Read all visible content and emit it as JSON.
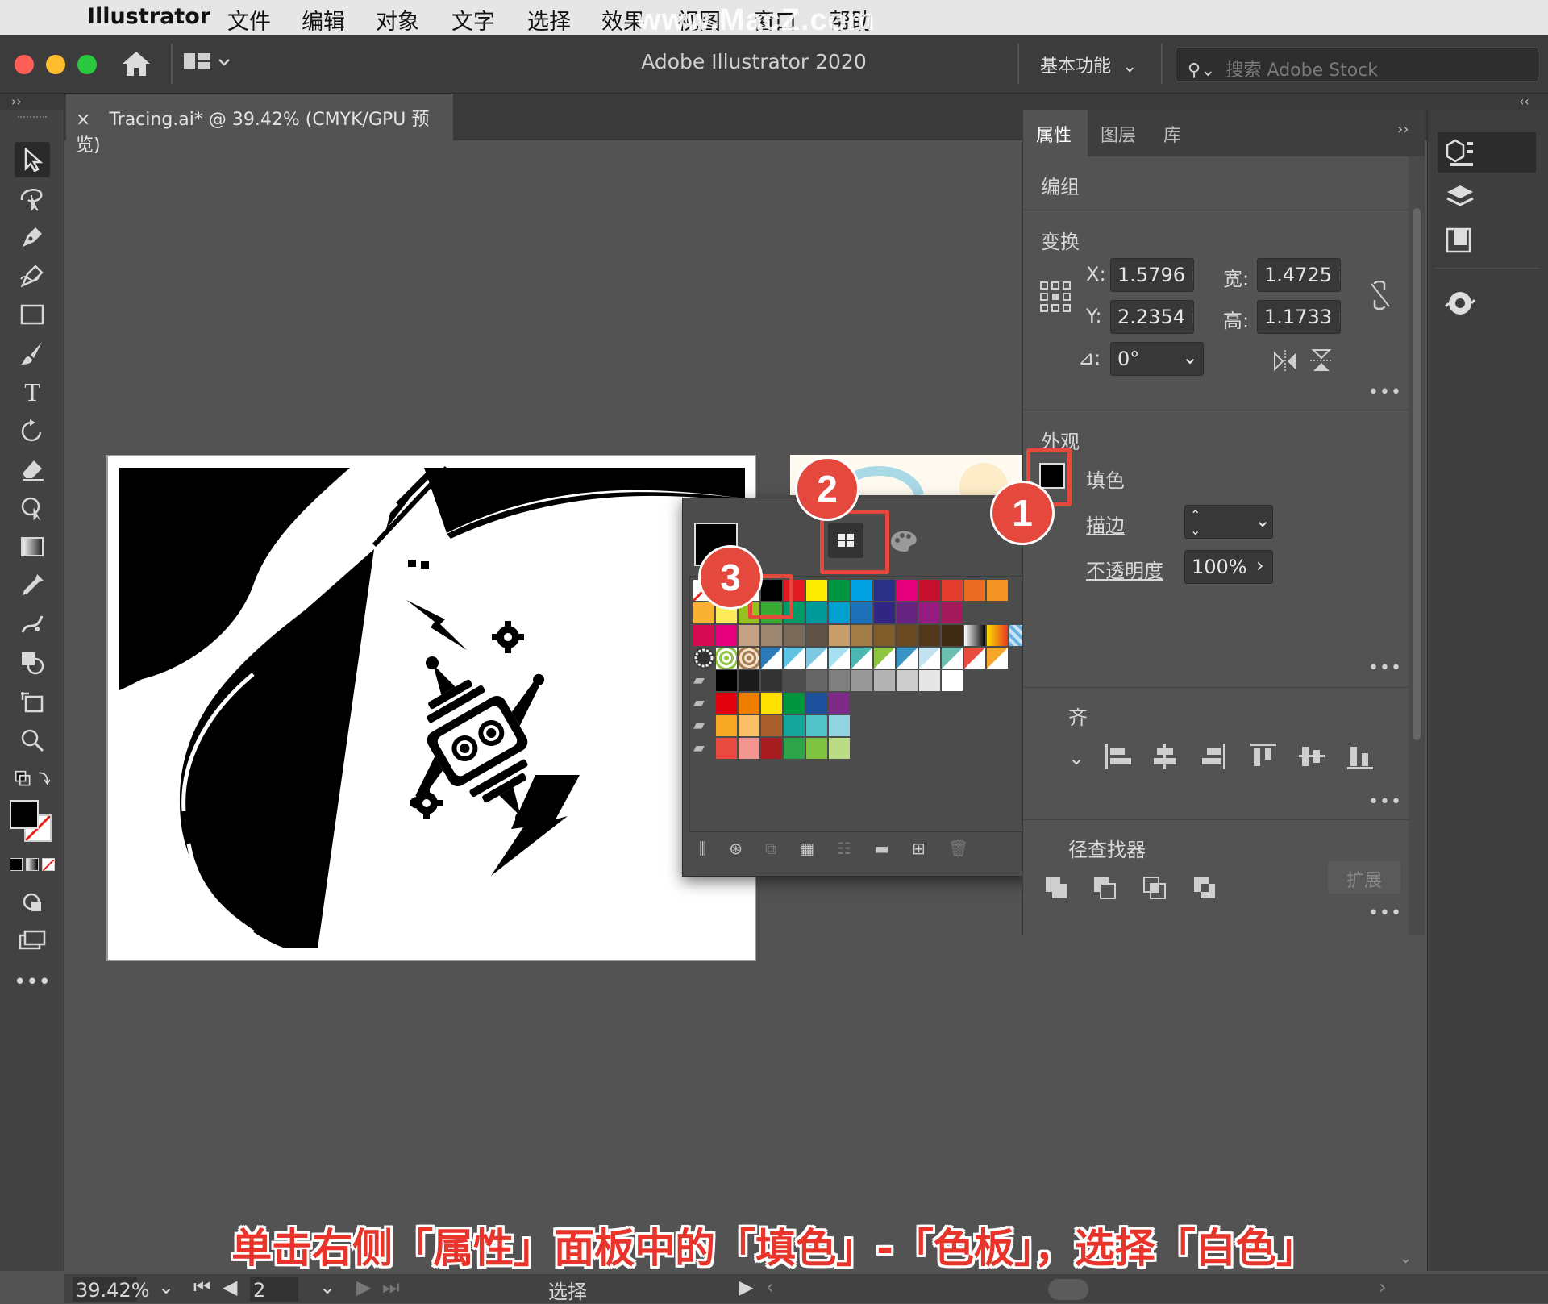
{
  "menubar": {
    "app": "Illustrator",
    "items": [
      "文件",
      "编辑",
      "对象",
      "文字",
      "选择",
      "效果",
      "视图",
      "窗口",
      "帮助"
    ]
  },
  "watermark": "www.MacZ.com",
  "window": {
    "title": "Adobe Illustrator 2020",
    "workspace": "基本功能",
    "stock_placeholder": "搜索 Adobe Stock"
  },
  "document_tab": {
    "close": "×",
    "label": "Tracing.ai* @ 39.42% (CMYK/GPU 预览)"
  },
  "properties_panel": {
    "tabs": [
      "属性",
      "图层",
      "库"
    ],
    "selection_type": "编组",
    "transform": {
      "header": "变换",
      "x_label": "X:",
      "x_value": "1.5796 i",
      "y_label": "Y:",
      "y_value": "2.2354 i",
      "w_label": "宽:",
      "w_value": "1.4725 ii",
      "h_label": "高:",
      "h_value": "1.1733 ii",
      "angle_value": "0°"
    },
    "appearance": {
      "header": "外观",
      "fill_label": "填色",
      "stroke_label": "描边",
      "opacity_label": "不透明度",
      "opacity_value": "100%"
    },
    "align_header_fragment": "齐",
    "pathfinder": {
      "header": "径查找器",
      "expand_button": "扩展"
    }
  },
  "swatches": {
    "colors": {
      "row1": [
        "#000000",
        "#e21a23",
        "#ffed00",
        "#009640",
        "#00a0e3",
        "#2b3087",
        "#e6007e",
        "#c8102e",
        "#e53e30",
        "#ec6b24",
        "#f39323"
      ],
      "row2": [
        "#f9b233",
        "#fdeb5b",
        "#95c11f",
        "#3aaa35",
        "#009a66",
        "#009999",
        "#00a1d1",
        "#1d71b8",
        "#312783",
        "#662483",
        "#951b81",
        "#a3195b"
      ],
      "row3": [
        "#d60b52",
        "#e6007e",
        "#c5a283",
        "#9d8771",
        "#7a6a5a",
        "#5e5145",
        "#c79e6a",
        "#a27b47",
        "#815d2b",
        "#6a4b21",
        "#51381a",
        "#3f2a14"
      ],
      "row5": [
        "#000000",
        "#1b1b1b",
        "#333333",
        "#4d4d4d",
        "#666666",
        "#808080",
        "#999999",
        "#b3b3b3",
        "#cccccc",
        "#e6e6e6",
        "#ffffff"
      ],
      "group1": [
        "#e3000f",
        "#ef7d00",
        "#ffe000",
        "#00963f",
        "#1d4f9c",
        "#7d2a89"
      ],
      "group2": [
        "#f7a823",
        "#fbc065",
        "#a85f2b",
        "#15a59b",
        "#4fc3c8",
        "#8fd4e0"
      ],
      "group3": [
        "#e94a3f",
        "#f3948f",
        "#a61c1f",
        "#2da34a",
        "#80c242",
        "#b9dc85"
      ]
    }
  },
  "statusbar": {
    "zoom": "39.42%",
    "artboard": "2",
    "tool": "选择"
  },
  "badges": [
    "1",
    "2",
    "3"
  ],
  "caption": "单击右侧「属性」面板中的「填色」-「色板」，选择「白色」",
  "colors": {
    "accent": "#e5483d",
    "panel": "#535353",
    "dark": "#3c3c3c"
  }
}
